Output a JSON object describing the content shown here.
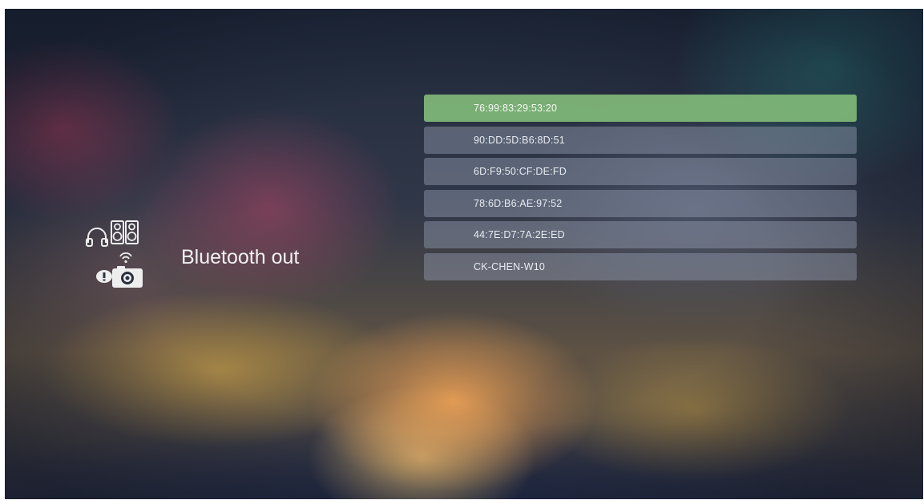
{
  "screen": {
    "title": "Bluetooth out",
    "icons": [
      "headphones-icon",
      "speakers-icon",
      "bluetooth-device-icon"
    ]
  },
  "device_list": {
    "selected_index": 0,
    "items": [
      {
        "label": "76:99:83:29:53:20"
      },
      {
        "label": "90:DD:5D:B6:8D:51"
      },
      {
        "label": "6D:F9:50:CF:DE:FD"
      },
      {
        "label": "78:6D:B6:AE:97:52"
      },
      {
        "label": "44:7E:D7:7A:2E:ED"
      },
      {
        "label": "CK-CHEN-W10"
      }
    ]
  },
  "colors": {
    "selected_item": "#80b978",
    "item": "#949eb2",
    "text": "#f1f1f1"
  }
}
